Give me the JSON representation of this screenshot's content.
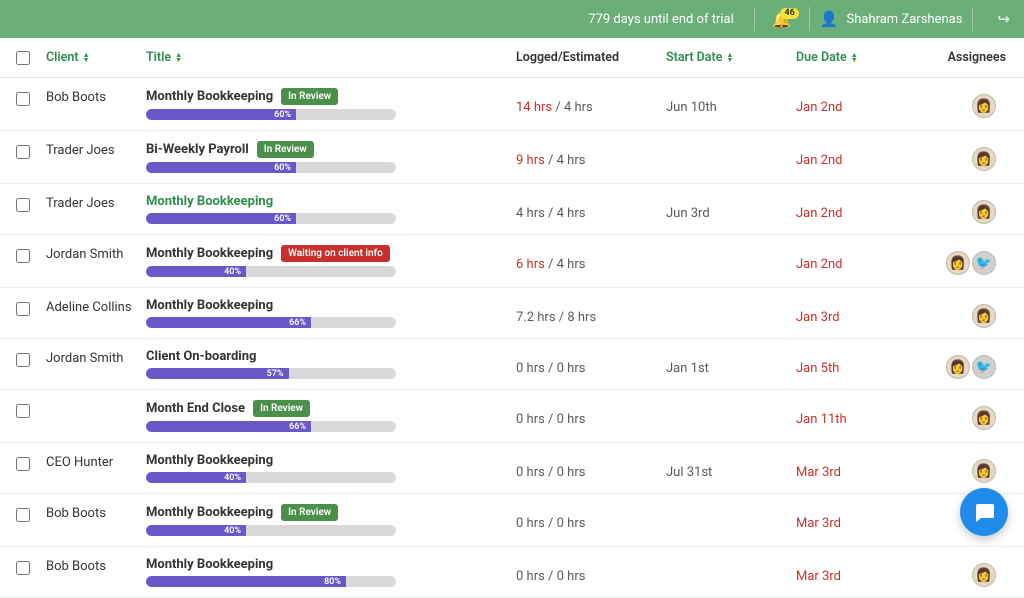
{
  "header": {
    "trial_text": "779 days until end of trial",
    "notification_count": "46",
    "user_name": "Shahram Zarshenas"
  },
  "columns": {
    "client": "Client",
    "title": "Title",
    "logged_estimated": "Logged/Estimated",
    "start_date": "Start Date",
    "due_date": "Due Date",
    "assignees": "Assignees"
  },
  "rows": [
    {
      "client": "Bob Boots",
      "title": "Monthly Bookkeeping",
      "title_green": false,
      "status": "In Review",
      "status_type": "review",
      "progress": 60,
      "logged": "14 hrs",
      "logged_over": true,
      "estimated": "4 hrs",
      "start": "Jun 10th",
      "due": "Jan 2nd",
      "assignees": [
        "a"
      ]
    },
    {
      "client": "Trader Joes",
      "title": "Bi-Weekly Payroll",
      "title_green": false,
      "status": "In Review",
      "status_type": "review",
      "progress": 60,
      "logged": "9 hrs",
      "logged_over": true,
      "estimated": "4 hrs",
      "start": "",
      "due": "Jan 2nd",
      "assignees": [
        "a"
      ]
    },
    {
      "client": "Trader Joes",
      "title": "Monthly Bookkeeping",
      "title_green": true,
      "status": "",
      "status_type": "",
      "progress": 60,
      "logged": "4 hrs",
      "logged_over": false,
      "estimated": "4 hrs",
      "start": "Jun 3rd",
      "due": "Jan 2nd",
      "assignees": [
        "a"
      ]
    },
    {
      "client": "Jordan Smith",
      "title": "Monthly Bookkeeping",
      "title_green": false,
      "status": "Waiting on client info",
      "status_type": "waiting",
      "progress": 40,
      "logged": "6 hrs",
      "logged_over": true,
      "estimated": "4 hrs",
      "start": "",
      "due": "Jan 2nd",
      "assignees": [
        "a",
        "b"
      ]
    },
    {
      "client": "Adeline Collins",
      "title": "Monthly Bookkeeping",
      "title_green": false,
      "status": "",
      "status_type": "",
      "progress": 66,
      "logged": "7.2 hrs",
      "logged_over": false,
      "estimated": "8 hrs",
      "start": "",
      "due": "Jan 3rd",
      "assignees": [
        "a"
      ]
    },
    {
      "client": "Jordan Smith",
      "title": "Client On-boarding",
      "title_green": false,
      "status": "",
      "status_type": "",
      "progress": 57,
      "logged": "0 hrs",
      "logged_over": false,
      "estimated": "0 hrs",
      "start": "Jan 1st",
      "due": "Jan 5th",
      "assignees": [
        "a",
        "b"
      ]
    },
    {
      "client": "",
      "title": "Month End Close",
      "title_green": false,
      "status": "In Review",
      "status_type": "review",
      "progress": 66,
      "logged": "0 hrs",
      "logged_over": false,
      "estimated": "0 hrs",
      "start": "",
      "due": "Jan 11th",
      "assignees": [
        "a"
      ]
    },
    {
      "client": "CEO Hunter",
      "title": "Monthly Bookkeeping",
      "title_green": false,
      "status": "",
      "status_type": "",
      "progress": 40,
      "logged": "0 hrs",
      "logged_over": false,
      "estimated": "0 hrs",
      "start": "Jul 31st",
      "due": "Mar 3rd",
      "assignees": [
        "a"
      ]
    },
    {
      "client": "Bob Boots",
      "title": "Monthly Bookkeeping",
      "title_green": false,
      "status": "In Review",
      "status_type": "review",
      "progress": 40,
      "logged": "0 hrs",
      "logged_over": false,
      "estimated": "0 hrs",
      "start": "",
      "due": "Mar 3rd",
      "assignees": [
        "a"
      ]
    },
    {
      "client": "Bob Boots",
      "title": "Monthly Bookkeeping",
      "title_green": false,
      "status": "",
      "status_type": "",
      "progress": 80,
      "logged": "0 hrs",
      "logged_over": false,
      "estimated": "0 hrs",
      "start": "",
      "due": "Mar 3rd",
      "assignees": [
        "a"
      ]
    }
  ]
}
